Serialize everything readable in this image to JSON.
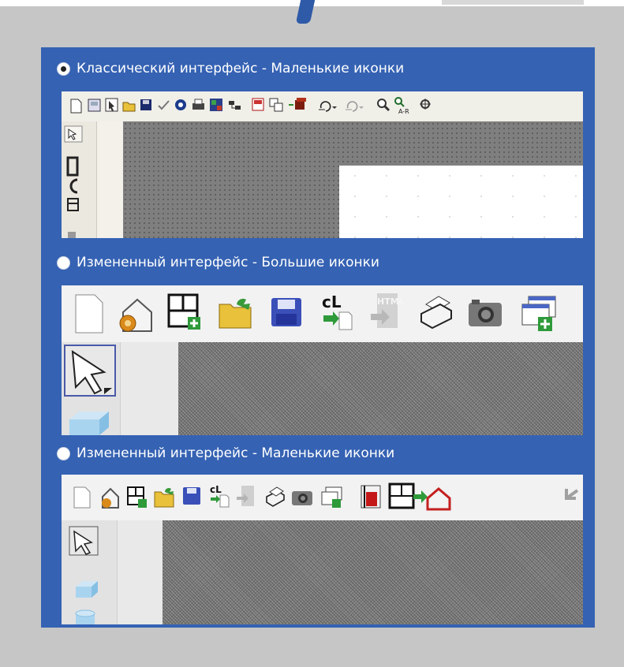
{
  "options": [
    {
      "label": "Классический интерфейс - Маленькие иконки",
      "selected": true
    },
    {
      "label": "Измененный интерфейс - Большие иконки",
      "selected": false
    },
    {
      "label": "Измененный интерфейс -  Маленькие иконки",
      "selected": false
    }
  ],
  "colors": {
    "panel": "#3562b3",
    "background": "#c6c6c6",
    "canvas": "#7f7f7f"
  },
  "icons": {
    "classic_toolbar": [
      "new-document-icon",
      "open-template-icon",
      "cursor-page-icon",
      "open-folder-icon",
      "save-icon",
      "check-icon",
      "at-sign-icon",
      "print-icon",
      "grid-color-icon",
      "network-icon",
      "window-icon",
      "shapes-icon",
      "box-arrow-icon",
      "undo-icon",
      "redo-icon",
      "zoom-icon",
      "zoom-fit-icon",
      "crosshair-icon"
    ],
    "large_toolbar": [
      "new-document-icon",
      "house-settings-icon",
      "floor-plan-add-icon",
      "open-folder-icon",
      "save-icon",
      "cl-export-icon",
      "html-export-icon",
      "print-icon",
      "camera-icon",
      "window-add-icon"
    ],
    "small_toolbar": [
      "new-document-icon",
      "house-settings-icon",
      "floor-plan-add-icon",
      "open-folder-icon",
      "save-icon",
      "cl-export-icon",
      "html-export-icon",
      "print-icon",
      "camera-icon",
      "window-add-icon",
      "red-door-icon",
      "plan-to-house-icon",
      "undo-icon"
    ]
  }
}
